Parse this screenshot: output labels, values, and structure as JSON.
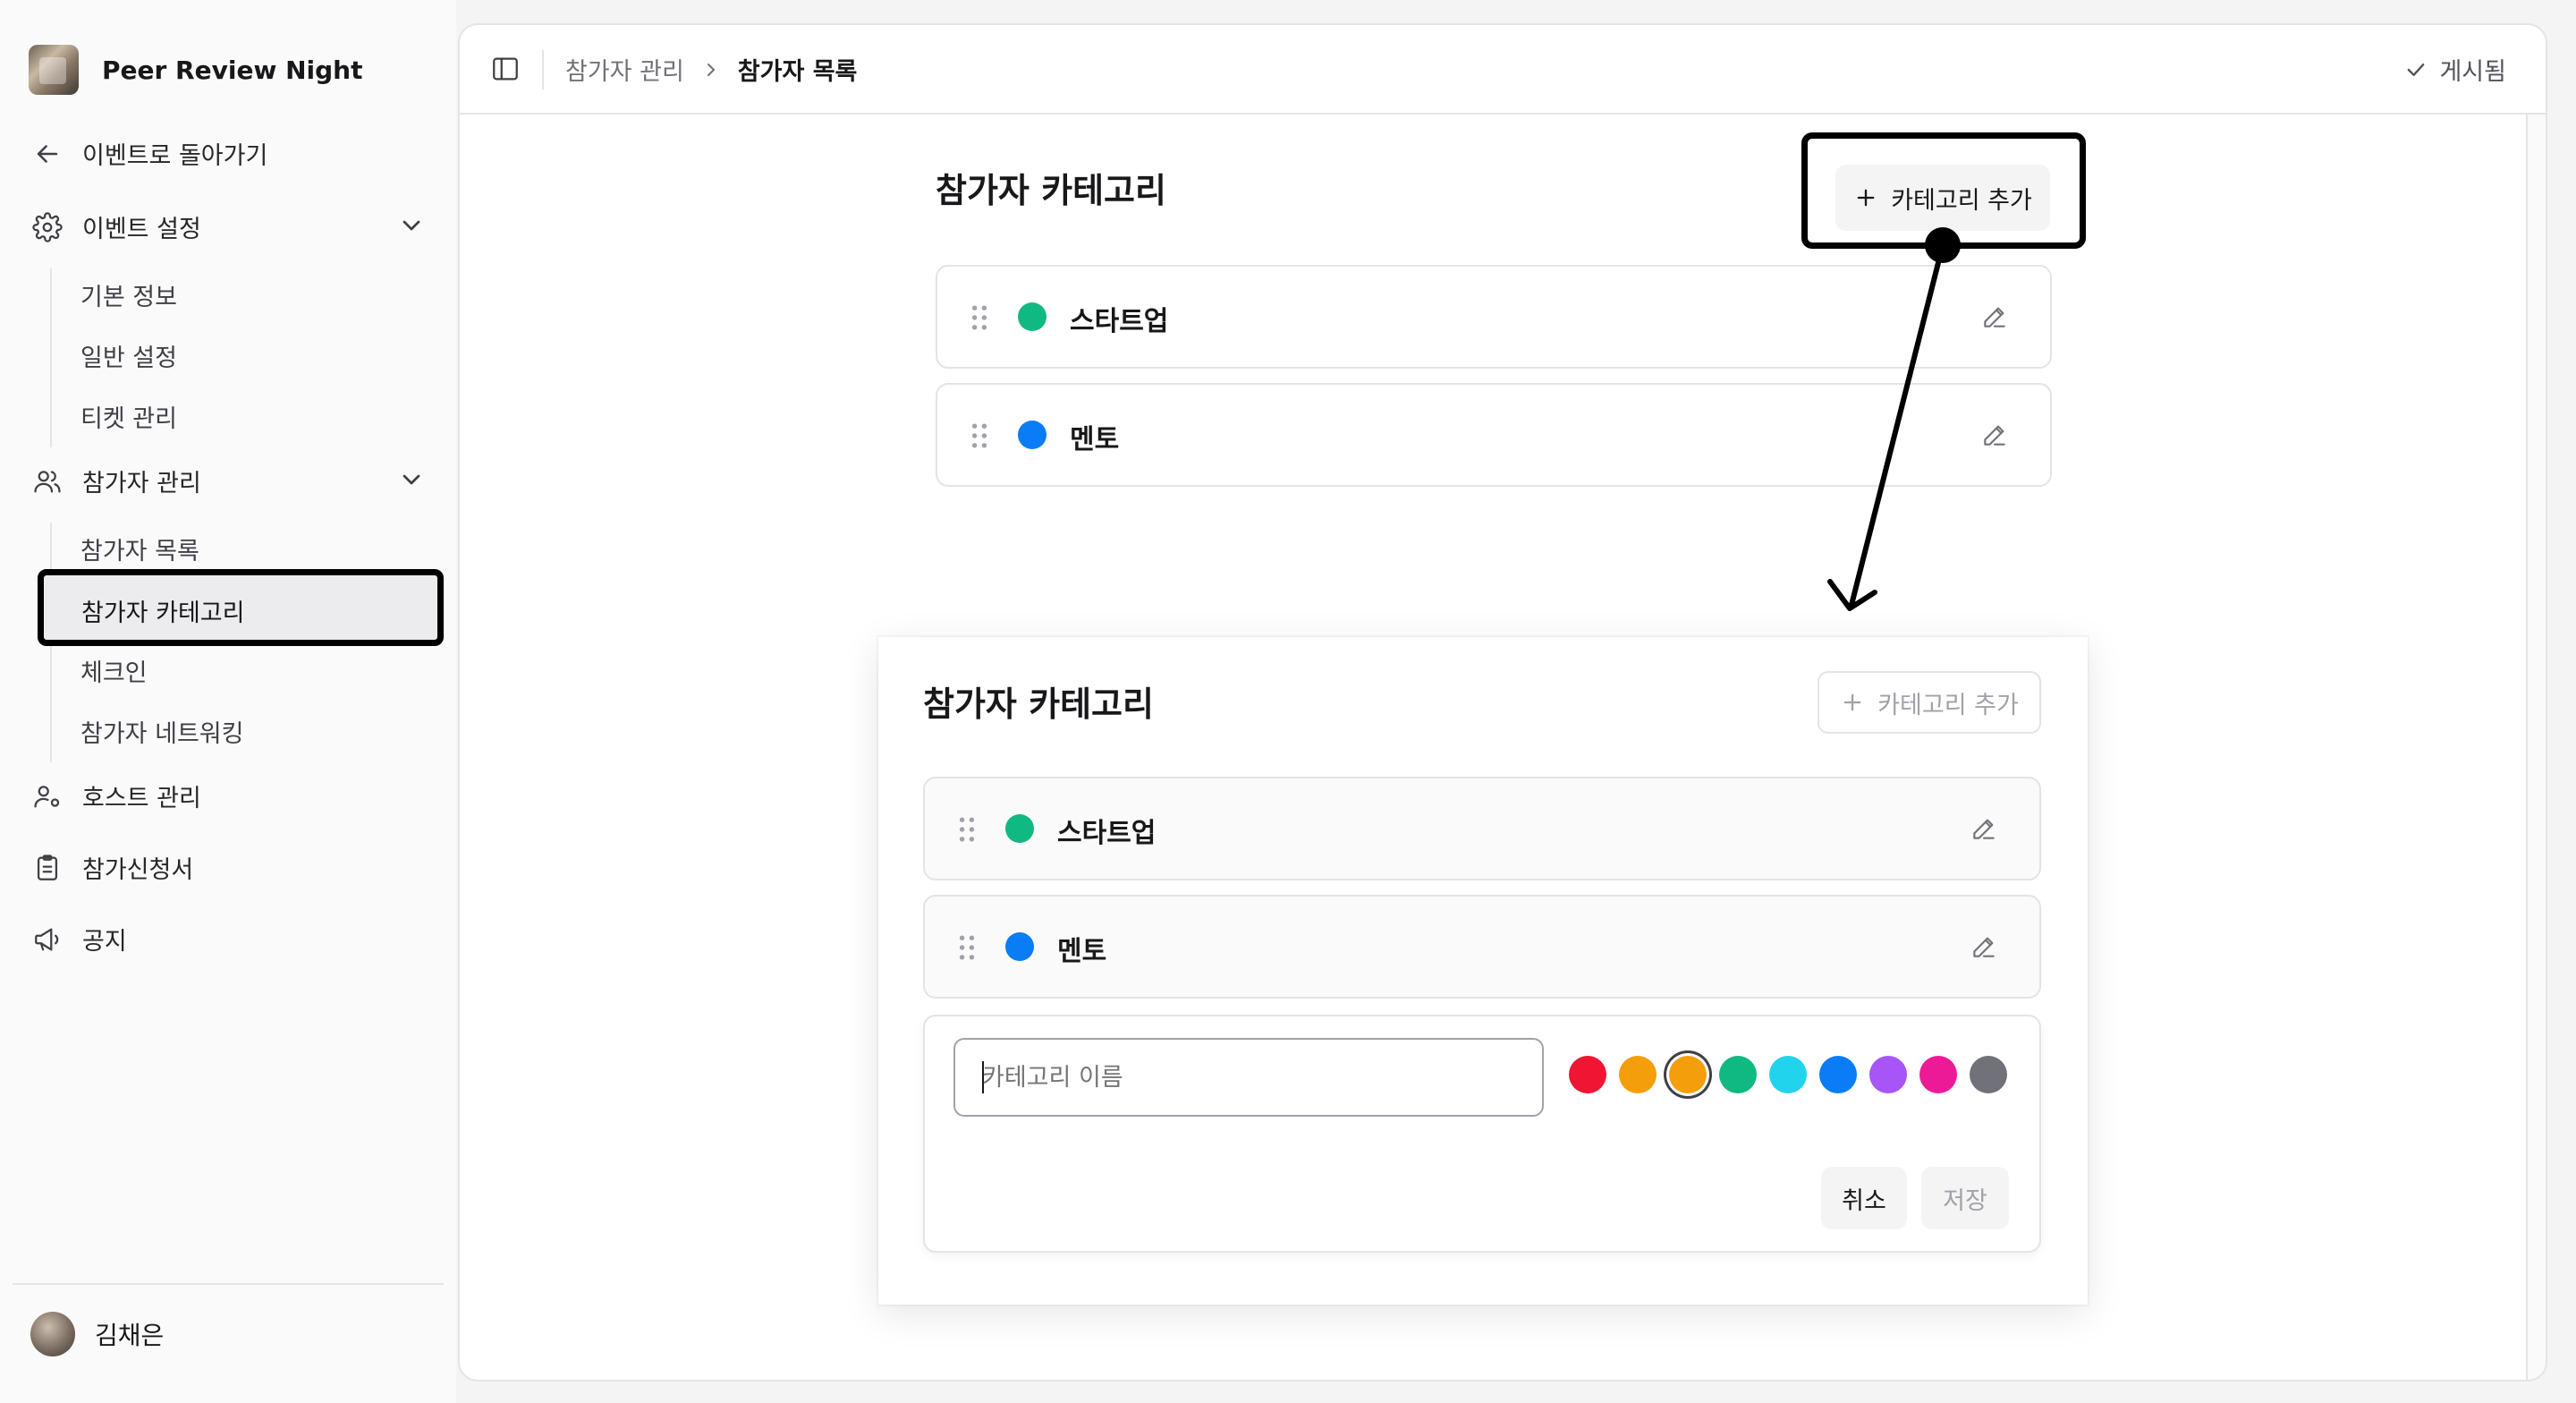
{
  "sidebar": {
    "brand_title": "Peer Review Night",
    "back_label": "이벤트로 돌아가기",
    "event_settings": {
      "label": "이벤트 설정",
      "items": [
        "기본 정보",
        "일반 설정",
        "티켓 관리"
      ]
    },
    "participants": {
      "label": "참가자 관리",
      "items": [
        "참가자 목록",
        "참가자 카테고리",
        "체크인",
        "참가자 네트워킹"
      ]
    },
    "host_label": "호스트 관리",
    "application_label": "참가신청서",
    "notice_label": "공지",
    "user_name": "김채은"
  },
  "topbar": {
    "breadcrumb_parent": "참가자 관리",
    "breadcrumb_current": "참가자 목록",
    "status": "게시됨"
  },
  "section": {
    "title": "참가자 카테고리",
    "add_label": "카테고리 추가",
    "categories": [
      {
        "name": "스타트업",
        "color": "#10b981"
      },
      {
        "name": "멘토",
        "color": "#0a7cf5"
      }
    ]
  },
  "form": {
    "name_placeholder": "카테고리 이름",
    "cancel_label": "취소",
    "save_label": "저장",
    "swatch_colors": [
      "#ef1533",
      "#f59e0b",
      "#f59e0b",
      "#10b981",
      "#22d3ee",
      "#0a7cf5",
      "#a855f7",
      "#ec1a96",
      "#71717a"
    ],
    "selected_index": 2
  }
}
